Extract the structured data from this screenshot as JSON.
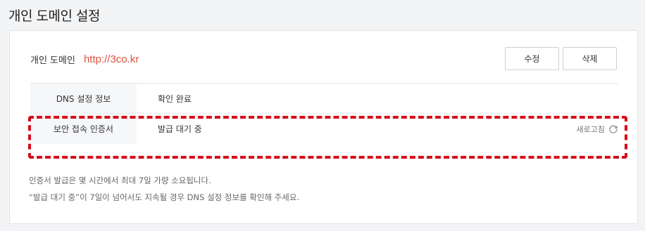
{
  "page": {
    "title": "개인 도메인 설정"
  },
  "domain": {
    "label": "개인 도메인",
    "value": "http://3co.kr"
  },
  "actions": {
    "edit_label": "수정",
    "delete_label": "삭제"
  },
  "info_rows": [
    {
      "key": "DNS 설정 정보",
      "value": "확인 완료"
    },
    {
      "key": "보안 접속 인증서",
      "value": "발급 대기 중",
      "action_label": "새로고침"
    }
  ],
  "notes": [
    "인증서 발급은 몇 시간에서 최대 7일 가량 소요됩니다.",
    "“발급 대기 중”이 7일이 넘어서도 지속될 경우 DNS 설정 정보를 확인해 주세요."
  ],
  "colors": {
    "domain_value": "#e0533d",
    "highlight_border": "#d80c18",
    "key_background": "#f6f7f9"
  },
  "icons": {
    "refresh": "refresh-icon"
  }
}
